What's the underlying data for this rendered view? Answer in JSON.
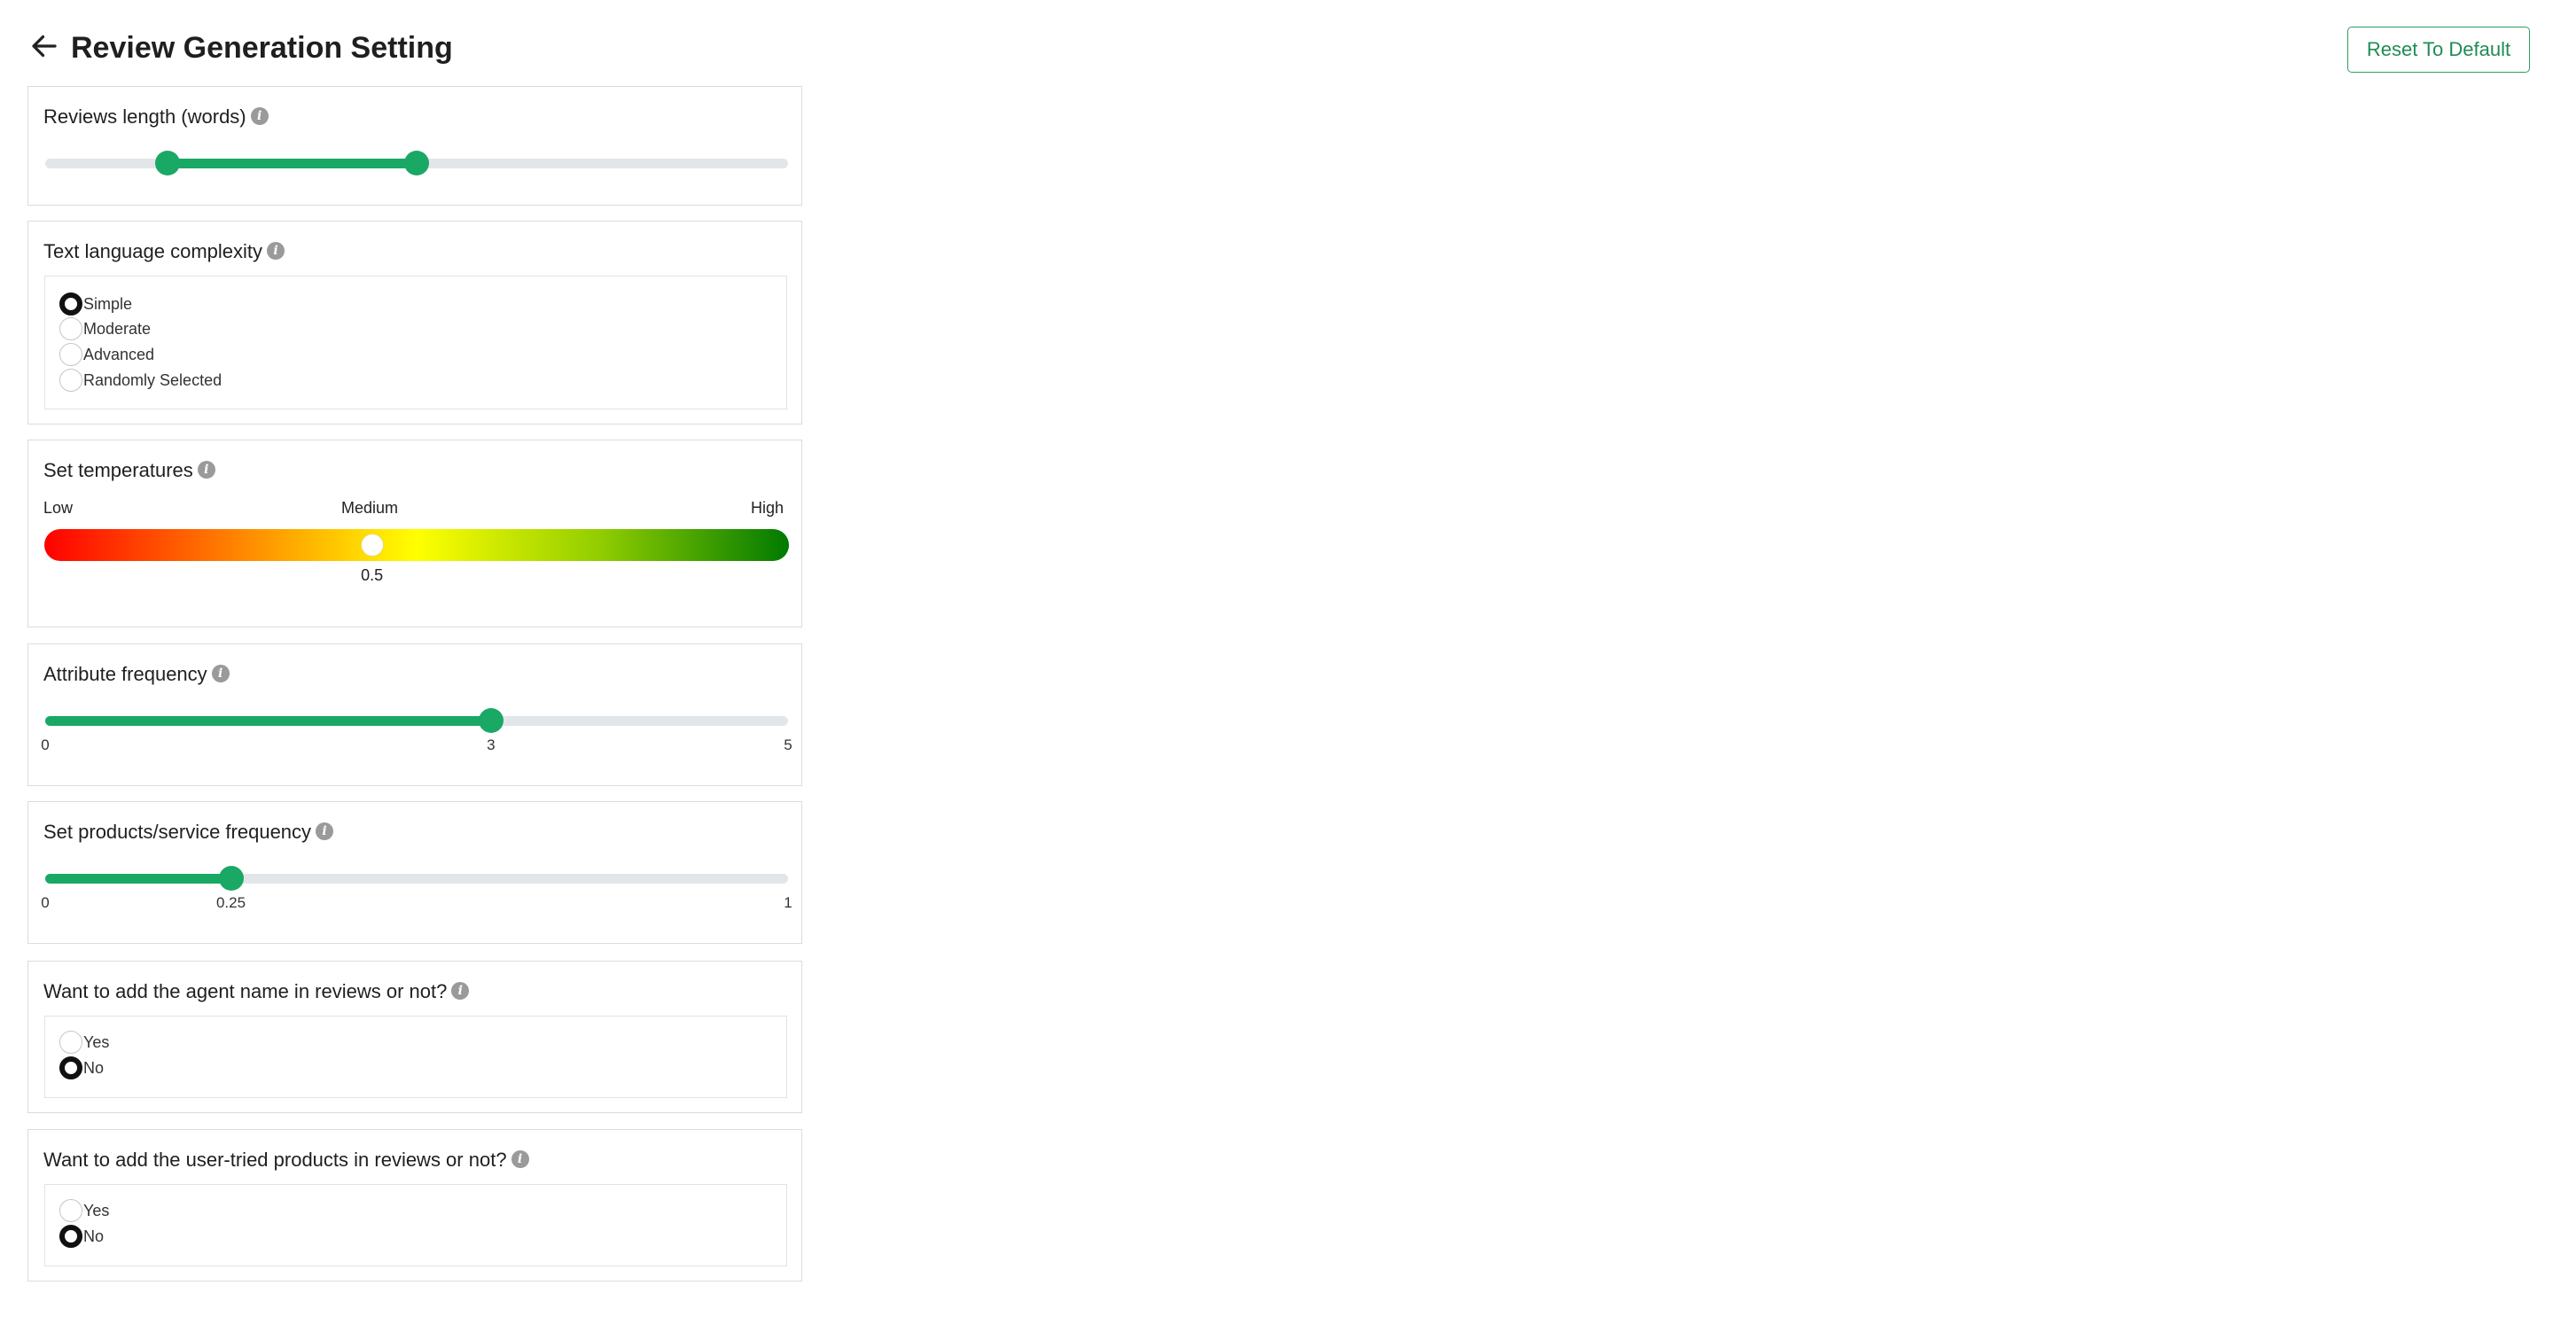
{
  "header": {
    "title": "Review Generation Setting",
    "reset_label": "Reset To Default"
  },
  "reviews_length": {
    "title": "Reviews length (words)",
    "range_fraction": [
      0.165,
      0.5
    ]
  },
  "complexity": {
    "title": "Text language complexity",
    "options": [
      "Simple",
      "Moderate",
      "Advanced",
      "Randomly Selected"
    ],
    "selected": "Simple"
  },
  "temperature": {
    "title": "Set temperatures",
    "low": "Low",
    "medium": "Medium",
    "high": "High",
    "value": "0.5",
    "value_fraction": 0.44
  },
  "attribute_frequency": {
    "title": "Attribute frequency",
    "min": "0",
    "current": "3",
    "max": "5",
    "value_fraction": 0.6
  },
  "product_frequency": {
    "title": "Set products/service frequency",
    "min": "0",
    "current": "0.25",
    "max": "1",
    "value_fraction": 0.25
  },
  "agent_name": {
    "title": "Want to add the agent name in reviews or not?",
    "options": [
      "Yes",
      "No"
    ],
    "selected": "No"
  },
  "user_tried": {
    "title": "Want to add the user-tried products in reviews or not?",
    "options": [
      "Yes",
      "No"
    ],
    "selected": "No"
  },
  "colors": {
    "accent": "#1aa865",
    "track": "#e3e6e8",
    "reset_border": "#2e9e62"
  },
  "icons": {
    "back": "arrow-left-icon",
    "info": "info-icon"
  }
}
